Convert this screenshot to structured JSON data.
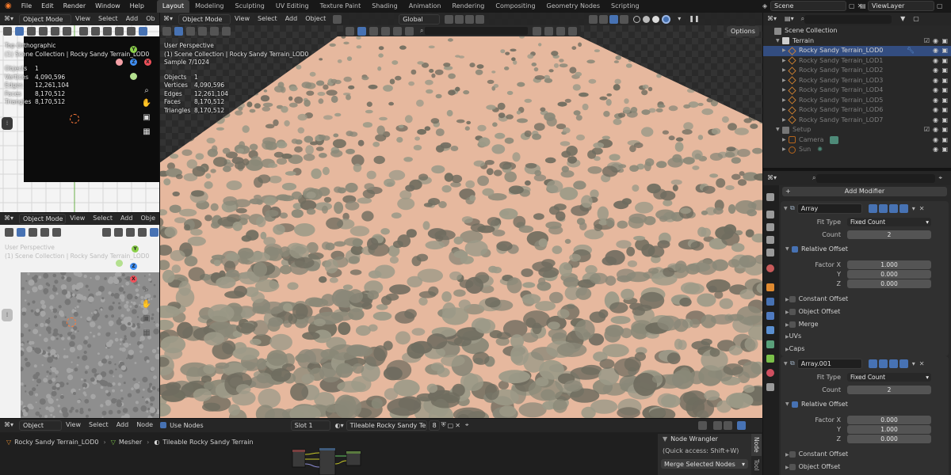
{
  "topbar": {
    "menus": [
      "File",
      "Edit",
      "Render",
      "Window",
      "Help"
    ],
    "workspaces": [
      "Layout",
      "Modeling",
      "Sculpting",
      "UV Editing",
      "Texture Paint",
      "Shading",
      "Animation",
      "Rendering",
      "Compositing",
      "Geometry Nodes",
      "Scripting"
    ],
    "active_workspace": "Layout",
    "scene": "Scene",
    "view_layer": "ViewLayer"
  },
  "viewport_small_top": {
    "mode": "Object Mode",
    "menus": [
      "View",
      "Select",
      "Add"
    ],
    "menu_cut": "Ob",
    "view_name": "Top Orthographic",
    "collection": "(1) Scene Collection | Rocky Sandy Terrain_LOD0",
    "stats": [
      {
        "label": "Objects",
        "value": "1"
      },
      {
        "label": "Vertices",
        "value": "4,090,596"
      },
      {
        "label": "Edges",
        "value": "12,261,104"
      },
      {
        "label": "Faces",
        "value": "8,170,512"
      },
      {
        "label": "Triangles",
        "value": "8,170,512"
      }
    ]
  },
  "viewport_small_bottom": {
    "mode": "Object Mode",
    "menus": [
      "View",
      "Select",
      "Add"
    ],
    "menu_cut": "Obje",
    "view_name": "User Perspective",
    "collection": "(1) Scene Collection | Rocky Sandy Terrain_LOD0"
  },
  "viewport_main": {
    "mode": "Object Mode",
    "menus": [
      "View",
      "Select",
      "Add",
      "Object"
    ],
    "transform": "Global",
    "view_name": "User Perspective",
    "collection": "(1) Scene Collection | Rocky Sandy Terrain_LOD0",
    "sample": "Sample 7/1024",
    "stats": [
      {
        "label": "Objects",
        "value": "1"
      },
      {
        "label": "Vertices",
        "value": "4,090,596"
      },
      {
        "label": "Edges",
        "value": "12,261,104"
      },
      {
        "label": "Faces",
        "value": "8,170,512"
      },
      {
        "label": "Triangles",
        "value": "8,170,512"
      }
    ],
    "options_label": "Options"
  },
  "gizmo_axes": {
    "x": "X",
    "y": "Y",
    "z": "Z"
  },
  "outliner": {
    "root": "Scene Collection",
    "collections": [
      {
        "name": "Terrain",
        "children": [
          {
            "name": "Rocky Sandy Terrain_LOD0",
            "active": true
          },
          {
            "name": "Rocky Sandy Terrain_LOD1",
            "active": false
          },
          {
            "name": "Rocky Sandy Terrain_LOD2",
            "active": false
          },
          {
            "name": "Rocky Sandy Terrain_LOD3",
            "active": false
          },
          {
            "name": "Rocky Sandy Terrain_LOD4",
            "active": false
          },
          {
            "name": "Rocky Sandy Terrain_LOD5",
            "active": false
          },
          {
            "name": "Rocky Sandy Terrain_LOD6",
            "active": false
          },
          {
            "name": "Rocky Sandy Terrain_LOD7",
            "active": false
          }
        ]
      },
      {
        "name": "Setup",
        "children": [
          {
            "name": "Camera",
            "active": false
          },
          {
            "name": "Sun",
            "active": false
          }
        ]
      }
    ]
  },
  "properties": {
    "add_modifier": "Add Modifier",
    "modifiers": [
      {
        "name": "Array",
        "fit_type_label": "Fit Type",
        "fit_type": "Fixed Count",
        "count_label": "Count",
        "count": "2",
        "relative_offset_label": "Relative Offset",
        "factor_labels": [
          "Factor X",
          "Y",
          "Z"
        ],
        "factors": [
          "1.000",
          "0.000",
          "0.000"
        ],
        "subpanels": [
          "Constant Offset",
          "Object Offset",
          "Merge",
          "UVs",
          "Caps"
        ]
      },
      {
        "name": "Array.001",
        "fit_type_label": "Fit Type",
        "fit_type": "Fixed Count",
        "count_label": "Count",
        "count": "2",
        "relative_offset_label": "Relative Offset",
        "factor_labels": [
          "Factor X",
          "Y",
          "Z"
        ],
        "factors": [
          "0.000",
          "1.000",
          "0.000"
        ],
        "subpanels": [
          "Constant Offset",
          "Object Offset"
        ]
      }
    ]
  },
  "node_editor": {
    "object_label": "Object",
    "menus": [
      "View",
      "Select",
      "Add",
      "Node"
    ],
    "use_nodes": "Use Nodes",
    "slot": "Slot 1",
    "material": "Tileable Rocky Sandy Terrain",
    "users": "8",
    "breadcrumb": [
      "Rocky Sandy Terrain_LOD0",
      "Mesher",
      "Tileable Rocky Sandy Terrain"
    ],
    "side_tabs": [
      "Node",
      "Tool"
    ],
    "panel_title": "Node Wrangler",
    "panel_hint": "(Quick access: Shift+W)",
    "panel_button": "Merge Selected Nodes"
  },
  "colors": {
    "accent": "#4772b3",
    "axis_x": "#f0505a",
    "axis_y": "#8bd04a",
    "axis_z": "#3f8ff5",
    "sand": "#e6b89e",
    "rock": "#8a8878"
  }
}
